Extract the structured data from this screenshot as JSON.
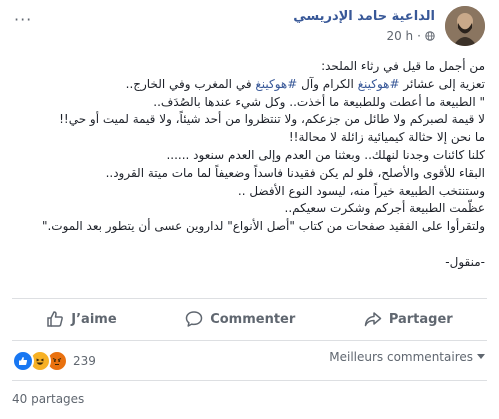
{
  "header": {
    "author": "الداعية حامد الإدريسي",
    "time": "20 h",
    "options_icon": "more-dots-icon",
    "globe_icon": "globe-icon"
  },
  "post": {
    "lines": [
      "من أجمل ما قيل في رثاء الملحد:",
      "تعزية إلى عشائر #هوكينغ الكرام وآل #هوكينغ في المغرب وفي الخارج..",
      "\" الطبيعة ما أعطت وللطبيعة ما أخذت.. وكل شيء عندها بالصُدَف..",
      "لا قيمة لصبركم ولا طائل من جزعكم، ولا تنتظروا من أحد شيئاً، ولا قيمة لميت أو حي!!",
      "ما نحن إلا حثالة كيميائية زائلة لا محالة!!",
      "كلنا كائنات وجدنا لنهلك.. وبعثنا من العدم وإلى العدم سنعود ......",
      "البقاء للأقوى والأصلح، فلو لم يكن فقيدنا فاسداً وضعيفاً لما مات ميتة القرود..",
      "وستنتخب الطبيعة خيراً منه، ليسود النوع الأفضل ..",
      "عظّمت الطبيعة أجركم وشكرت سعيكم..",
      "ولتقرأوا على الفقيد صفحات من كتاب \"أصل الأنواع\" لداروين عسى أن يتطور بعد الموت.\"",
      "",
      "-منقول-"
    ]
  },
  "actions": {
    "like": "J’aime",
    "comment": "Commenter",
    "share": "Partager"
  },
  "stats": {
    "reaction_count": "239",
    "sort_label": "Meilleurs commentaires",
    "shares_label": "40 partages"
  },
  "colors": {
    "link": "#385898",
    "muted": "#606770",
    "like_blue": "#1877f2",
    "haha_yellow": "#f7b125",
    "angry_red": "#e9710f"
  }
}
